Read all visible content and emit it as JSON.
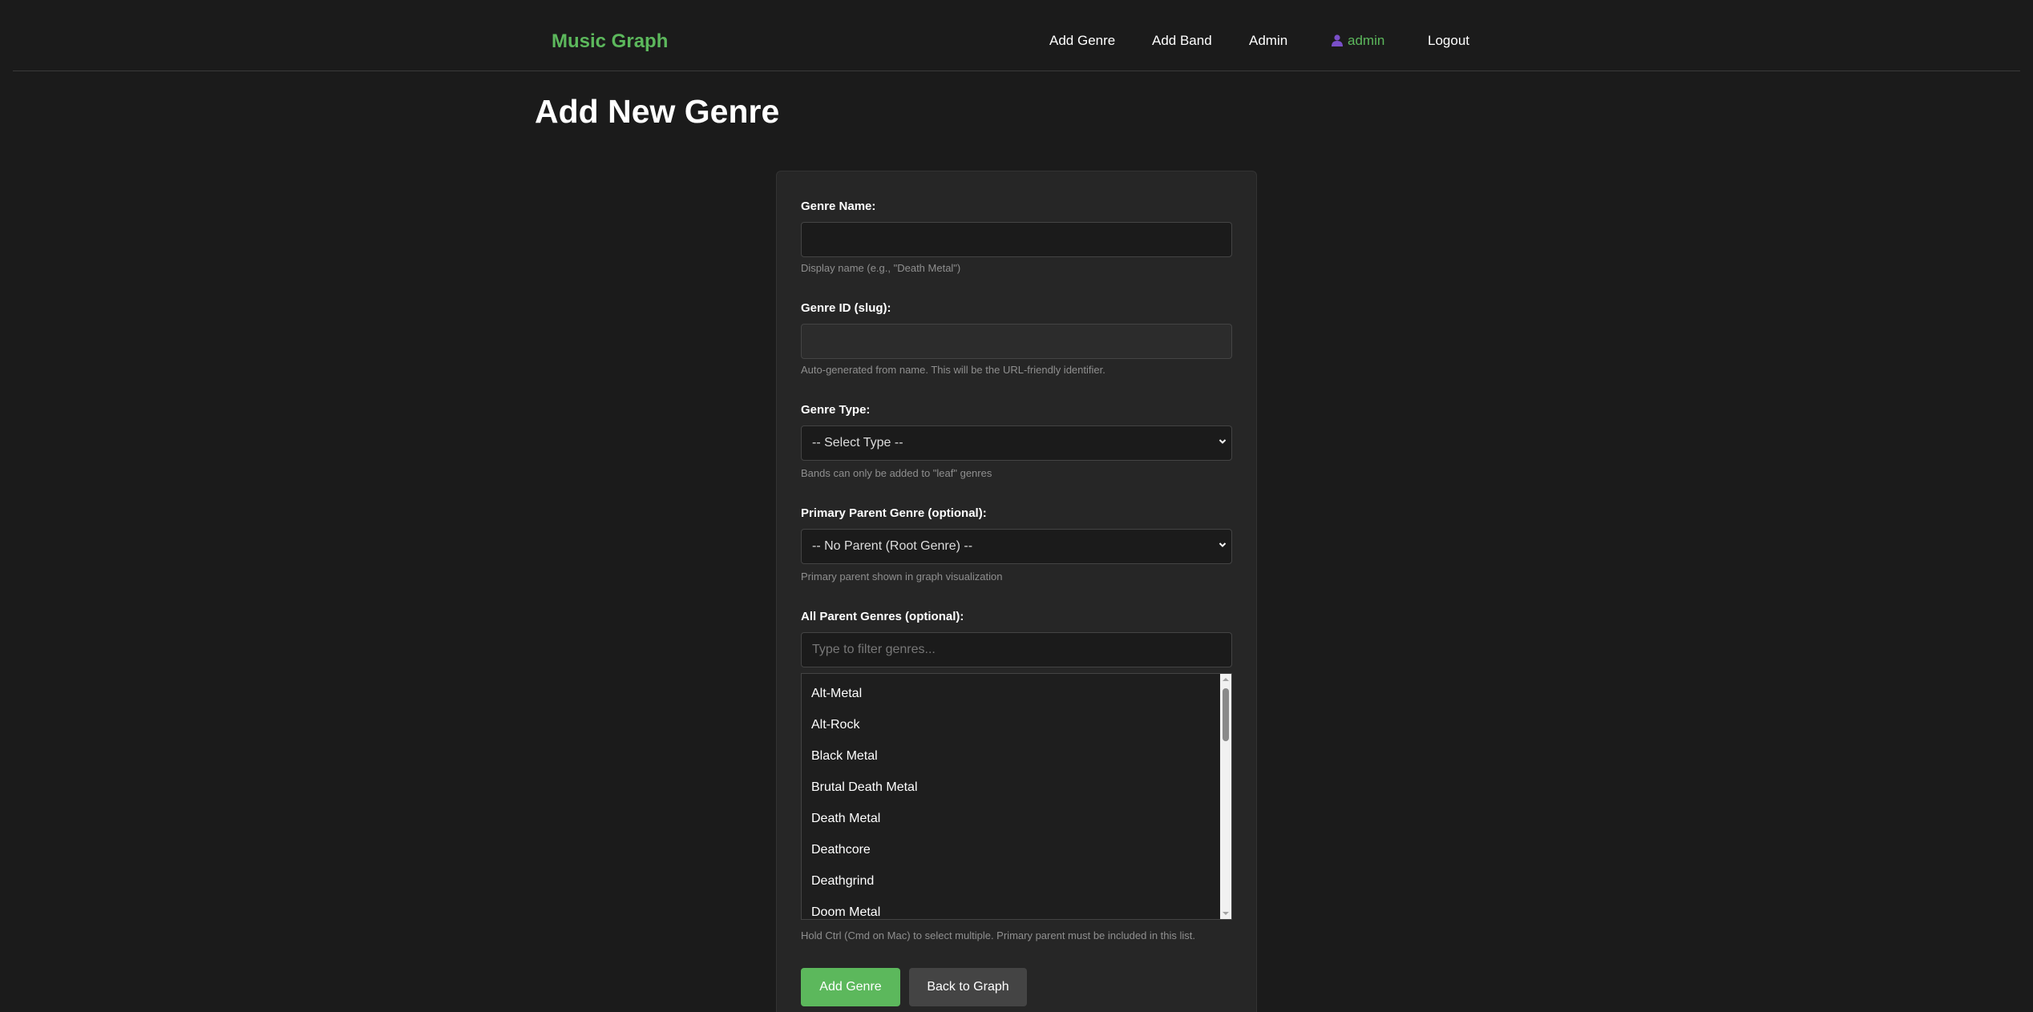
{
  "nav": {
    "brand": "Music Graph",
    "links": [
      "Add Genre",
      "Add Band",
      "Admin"
    ],
    "user": "admin",
    "logout": "Logout"
  },
  "page": {
    "title": "Add New Genre"
  },
  "form": {
    "genre_name": {
      "label": "Genre Name:",
      "value": "",
      "help": "Display name (e.g., \"Death Metal\")"
    },
    "genre_id": {
      "label": "Genre ID (slug):",
      "value": "",
      "help": "Auto-generated from name. This will be the URL-friendly identifier."
    },
    "genre_type": {
      "label": "Genre Type:",
      "selected": "-- Select Type --",
      "help": "Bands can only be added to \"leaf\" genres"
    },
    "primary_parent": {
      "label": "Primary Parent Genre (optional):",
      "selected": "-- No Parent (Root Genre) --",
      "help": "Primary parent shown in graph visualization"
    },
    "all_parents": {
      "label": "All Parent Genres (optional):",
      "filter_placeholder": "Type to filter genres...",
      "options": [
        "Alt-Metal",
        "Alt-Rock",
        "Black Metal",
        "Brutal Death Metal",
        "Death Metal",
        "Deathcore",
        "Deathgrind",
        "Doom Metal"
      ],
      "help": "Hold Ctrl (Cmd on Mac) to select multiple. Primary parent must be included in this list."
    },
    "submit_label": "Add Genre",
    "back_label": "Back to Graph"
  },
  "colors": {
    "accent": "#5cb85c",
    "user_icon": "#7a4fc9",
    "background": "#1b1b1b",
    "card": "#262626"
  }
}
